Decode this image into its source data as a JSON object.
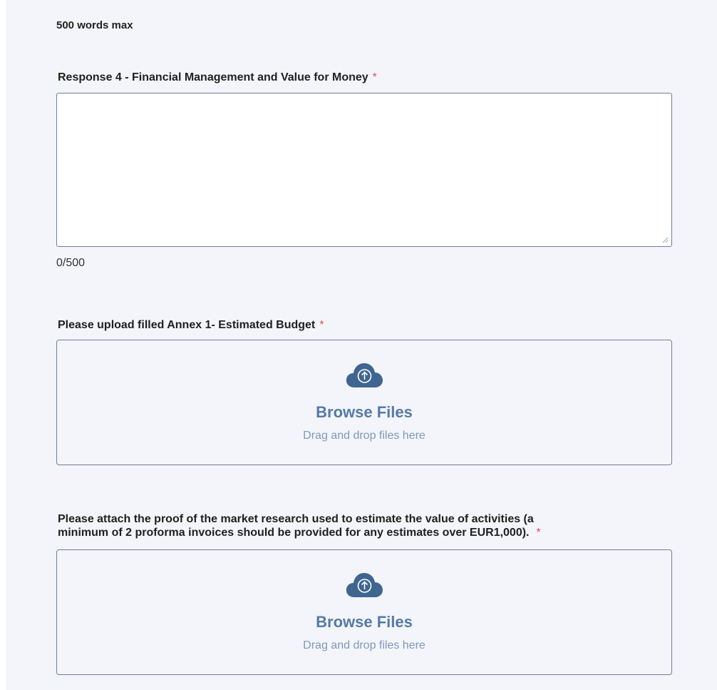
{
  "hint": "500 words max",
  "response4": {
    "label": "Response 4 - Financial Management and Value for Money",
    "required_mark": "*",
    "value": "",
    "counter": "0/500"
  },
  "upload1": {
    "label": "Please upload filled Annex 1- Estimated Budget",
    "required_mark": "*",
    "title": "Browse Files",
    "subtitle": "Drag and drop files here",
    "icon": "cloud-upload-icon"
  },
  "upload2": {
    "label_line1": "Please attach the proof of the market research used to estimate the value of activities (a",
    "label_line2": "minimum of 2 proforma invoices should be provided for any estimates over EUR1,000).",
    "required_mark": "*",
    "title": "Browse Files",
    "subtitle": "Drag and drop files here",
    "icon": "cloud-upload-icon"
  },
  "colors": {
    "background": "#f3f5fa",
    "border": "#6f7f97",
    "accent": "#557aa5",
    "icon": "#3f6591",
    "required": "#d9534f"
  }
}
